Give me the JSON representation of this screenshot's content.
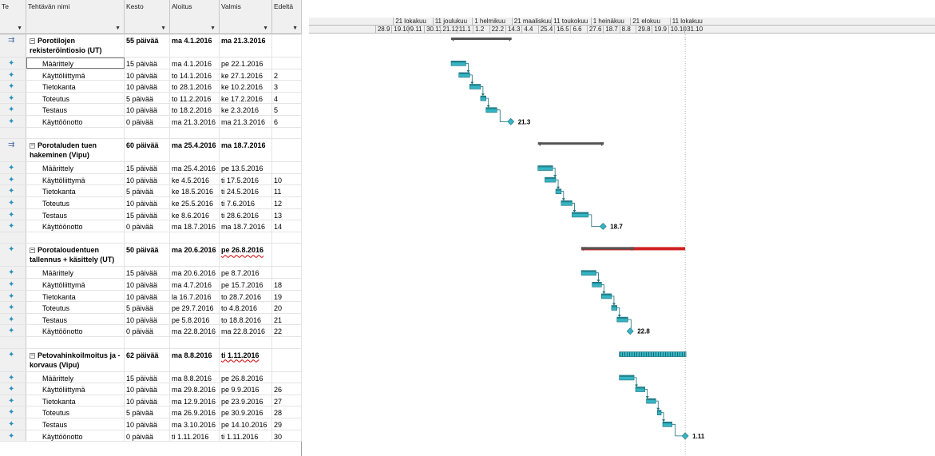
{
  "columns": {
    "indicator": "Te",
    "name": "Tehtävän nimi",
    "duration": "Kesto",
    "start": "Aloitus",
    "finish": "Valmis",
    "pred": "Edeltä"
  },
  "timescale": {
    "months": [
      "21 lokakuu",
      "11 joulukuu",
      "1 helmikuu",
      "21 maaliskuu",
      "11 toukokuu",
      "1 heinäkuu",
      "21 elokuu",
      "11 lokakuu"
    ],
    "days": [
      "28.9",
      "19.10",
      "9.11",
      "30.11",
      "21.12",
      "11.1",
      "1.2",
      "22.2",
      "14.3",
      "4.4",
      "25.4",
      "16.5",
      "6.6",
      "27.6",
      "18.7",
      "8.8",
      "29.8",
      "19.9",
      "10.10",
      "31.10"
    ]
  },
  "colors": {
    "bar": "#35b5c4",
    "summary": "#555555",
    "critical": "#d02020",
    "milestone": "#35b5c4"
  },
  "tasks": [
    {
      "type": "summary",
      "icon": "summary-icon",
      "name": "Porotilojen rekisteröintiosio (UT)",
      "duration": "55 päivää",
      "start": "ma 4.1.2016",
      "finish": "ma 21.3.2016",
      "pred": "",
      "s": "2016-01-04",
      "f": "2016-03-21"
    },
    {
      "type": "task",
      "icon": "pin-icon",
      "name": "Määrittely",
      "duration": "15 päivää",
      "start": "ma 4.1.2016",
      "finish": "pe 22.1.2016",
      "pred": "",
      "s": "2016-01-04",
      "f": "2016-01-22",
      "selected": true
    },
    {
      "type": "task",
      "icon": "pin-icon",
      "name": "Käyttöliittymä",
      "duration": "10 päivää",
      "start": "to 14.1.2016",
      "finish": "ke 27.1.2016",
      "pred": "2",
      "s": "2016-01-14",
      "f": "2016-01-27",
      "finish_flag": true
    },
    {
      "type": "task",
      "icon": "pin-icon",
      "name": "Tietokanta",
      "duration": "10 päivää",
      "start": "to 28.1.2016",
      "finish": "ke 10.2.2016",
      "pred": "3",
      "s": "2016-01-28",
      "f": "2016-02-10"
    },
    {
      "type": "task",
      "icon": "pin-icon",
      "name": "Toteutus",
      "duration": "5 päivää",
      "start": "to 11.2.2016",
      "finish": "ke 17.2.2016",
      "pred": "4",
      "s": "2016-02-11",
      "f": "2016-02-17"
    },
    {
      "type": "task",
      "icon": "pin-icon",
      "name": "Testaus",
      "duration": "10 päivää",
      "start": "to 18.2.2016",
      "finish": "ke 2.3.2016",
      "pred": "5",
      "s": "2016-02-18",
      "f": "2016-03-02"
    },
    {
      "type": "milestone",
      "icon": "pin-icon",
      "name": "Käyttöönotto",
      "duration": "0 päivää",
      "start": "ma 21.3.2016",
      "finish": "ma 21.3.2016",
      "pred": "6",
      "s": "2016-03-21",
      "f": "2016-03-21",
      "label": "21.3"
    },
    {
      "type": "blank"
    },
    {
      "type": "summary",
      "icon": "summary-icon",
      "name": "Porotaluden tuen hakeminen (Vipu)",
      "duration": "60 päivää",
      "start": "ma 25.4.2016",
      "finish": "ma 18.7.2016",
      "pred": "",
      "s": "2016-04-25",
      "f": "2016-07-18"
    },
    {
      "type": "task",
      "icon": "pin-icon",
      "name": "Määrittely",
      "duration": "15 päivää",
      "start": "ma 25.4.2016",
      "finish": "pe 13.5.2016",
      "pred": "",
      "s": "2016-04-25",
      "f": "2016-05-13"
    },
    {
      "type": "task",
      "icon": "pin-icon",
      "name": "Käyttöliittymä",
      "duration": "10 päivää",
      "start": "ke 4.5.2016",
      "finish": "ti 17.5.2016",
      "pred": "10",
      "s": "2016-05-04",
      "f": "2016-05-17",
      "finish_flag": true
    },
    {
      "type": "task",
      "icon": "pin-icon",
      "name": "Tietokanta",
      "duration": "5 päivää",
      "start": "ke 18.5.2016",
      "finish": "ti 24.5.2016",
      "pred": "11",
      "s": "2016-05-18",
      "f": "2016-05-24"
    },
    {
      "type": "task",
      "icon": "pin-icon",
      "name": "Toteutus",
      "duration": "10 päivää",
      "start": "ke 25.5.2016",
      "finish": "ti 7.6.2016",
      "pred": "12",
      "s": "2016-05-25",
      "f": "2016-06-07"
    },
    {
      "type": "task",
      "icon": "pin-icon",
      "name": "Testaus",
      "duration": "15 päivää",
      "start": "ke 8.6.2016",
      "finish": "ti 28.6.2016",
      "pred": "13",
      "s": "2016-06-08",
      "f": "2016-06-28"
    },
    {
      "type": "milestone",
      "icon": "pin-icon",
      "name": "Käyttöönotto",
      "duration": "0 päivää",
      "start": "ma 18.7.2016",
      "finish": "ma 18.7.2016",
      "pred": "14",
      "s": "2016-07-18",
      "f": "2016-07-18",
      "label": "18.7"
    },
    {
      "type": "blank"
    },
    {
      "type": "summary",
      "icon": "pin-icon",
      "name": "Porotaloudentuen tallennus + käsittely (UT)",
      "duration": "50 päivää",
      "start": "ma 20.6.2016",
      "finish": "pe 26.8.2016",
      "pred": "",
      "s": "2016-06-20",
      "f": "2016-08-26",
      "finish_flag": true,
      "critical_to": "2016-11-01"
    },
    {
      "type": "task",
      "icon": "pin-icon",
      "name": "Määrittely",
      "duration": "15 päivää",
      "start": "ma 20.6.2016",
      "finish": "pe 8.7.2016",
      "pred": "",
      "s": "2016-06-20",
      "f": "2016-07-08"
    },
    {
      "type": "task",
      "icon": "pin-icon",
      "name": "Käyttöliittymä",
      "duration": "10 päivää",
      "start": "ma 4.7.2016",
      "finish": "pe 15.7.2016",
      "pred": "18",
      "s": "2016-07-04",
      "f": "2016-07-15",
      "finish_flag": true
    },
    {
      "type": "task",
      "icon": "pin-icon",
      "name": "Tietokanta",
      "duration": "10 päivää",
      "start": "la 16.7.2016",
      "finish": "to 28.7.2016",
      "pred": "19",
      "s": "2016-07-16",
      "f": "2016-07-28",
      "finish_flag": true
    },
    {
      "type": "task",
      "icon": "pin-icon",
      "name": "Toteutus",
      "duration": "5 päivää",
      "start": "pe 29.7.2016",
      "finish": "to 4.8.2016",
      "pred": "20",
      "s": "2016-07-29",
      "f": "2016-08-04"
    },
    {
      "type": "task",
      "icon": "pin-icon",
      "name": "Testaus",
      "duration": "10 päivää",
      "start": "pe 5.8.2016",
      "finish": "to 18.8.2016",
      "pred": "21",
      "s": "2016-08-05",
      "f": "2016-08-18"
    },
    {
      "type": "milestone",
      "icon": "pin-icon",
      "name": "Käyttöönotto",
      "duration": "0 päivää",
      "start": "ma 22.8.2016",
      "finish": "ma 22.8.2016",
      "pred": "22",
      "s": "2016-08-22",
      "f": "2016-08-22",
      "label": "22.8"
    },
    {
      "type": "blank"
    },
    {
      "type": "summary",
      "icon": "pin-icon",
      "name": "Petovahinkoilmoitus ja -korvaus (Vipu)",
      "duration": "62 päivää",
      "start": "ma 8.8.2016",
      "finish": "ti 1.11.2016",
      "pred": "",
      "s": "2016-08-08",
      "f": "2016-11-01",
      "finish_flag": true,
      "manual": true
    },
    {
      "type": "task",
      "icon": "pin-icon",
      "name": "Määrittely",
      "duration": "15 päivää",
      "start": "ma 8.8.2016",
      "finish": "pe 26.8.2016",
      "pred": "",
      "s": "2016-08-08",
      "f": "2016-08-26"
    },
    {
      "type": "task",
      "icon": "pin-icon",
      "name": "Käyttöliittymä",
      "duration": "10 päivää",
      "start": "ma 29.8.2016",
      "finish": "pe 9.9.2016",
      "pred": "26",
      "s": "2016-08-29",
      "f": "2016-09-09",
      "finish_flag": true
    },
    {
      "type": "task",
      "icon": "pin-icon",
      "name": "Tietokanta",
      "duration": "10 päivää",
      "start": "ma 12.9.2016",
      "finish": "pe 23.9.2016",
      "pred": "27",
      "s": "2016-09-12",
      "f": "2016-09-23",
      "finish_flag": true
    },
    {
      "type": "task",
      "icon": "pin-icon",
      "name": "Toteutus",
      "duration": "5 päivää",
      "start": "ma 26.9.2016",
      "finish": "pe 30.9.2016",
      "pred": "28",
      "s": "2016-09-26",
      "f": "2016-09-30",
      "finish_flag": true
    },
    {
      "type": "task",
      "icon": "pin-icon",
      "name": "Testaus",
      "duration": "10 päivää",
      "start": "ma 3.10.2016",
      "finish": "pe 14.10.2016",
      "pred": "29",
      "s": "2016-10-03",
      "f": "2016-10-14",
      "finish_flag": true
    },
    {
      "type": "milestone",
      "icon": "pin-icon",
      "name": "Käyttöönotto",
      "duration": "0 päivää",
      "start": "ti 1.11.2016",
      "finish": "ti 1.11.2016",
      "pred": "30",
      "s": "2016-11-01",
      "f": "2016-11-01",
      "label": "1.11",
      "finish_flag": true
    }
  ]
}
